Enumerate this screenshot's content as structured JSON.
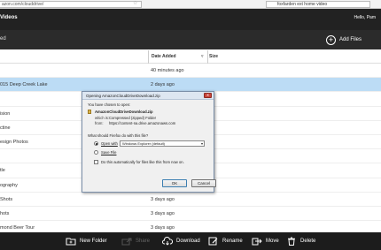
{
  "browser": {
    "url": "azon.com/clouddrive/",
    "search": "foxfarden ext home video"
  },
  "header": {
    "title": "Videos",
    "user": "Hello, Pam"
  },
  "subheader": {
    "title": "ed",
    "add_files": "Add Files"
  },
  "table": {
    "columns": {
      "date": "Date Added",
      "size": "Size"
    },
    "rows": [
      {
        "name": "",
        "date": "40 minutes ago",
        "selected": false
      },
      {
        "name": "015 Deep Creek Lake",
        "date": "2 days ago",
        "selected": true
      },
      {
        "name": "",
        "date": "",
        "selected": false
      },
      {
        "name": "ision",
        "date": "",
        "selected": false
      },
      {
        "name": "ctine",
        "date": "",
        "selected": false
      },
      {
        "name": "esign Photos",
        "date": "",
        "selected": false
      },
      {
        "name": "",
        "date": "",
        "selected": false
      },
      {
        "name": "tle",
        "date": "",
        "selected": false
      },
      {
        "name": "ography",
        "date": "",
        "selected": false
      },
      {
        "name": "Shots",
        "date": "3 days ago",
        "selected": false
      },
      {
        "name": "hots",
        "date": "3 days ago",
        "selected": false
      },
      {
        "name": "mond Beer Tour",
        "date": "3 days ago",
        "selected": false
      }
    ]
  },
  "toolbar": {
    "new_folder": "New Folder",
    "share": "Share",
    "download": "Download",
    "rename": "Rename",
    "move": "Move",
    "delete": "Delete"
  },
  "dialog": {
    "title": "Opening AmazonCloudDriveDownload.zip",
    "chosen": "You have chosen to open:",
    "filename": "AmazonCloudDriveDownload.zip",
    "which_is_label": "which is:",
    "which_is_value": "Compressed (zipped) Folder",
    "from_label": "from:",
    "from_value": "https://content-na.drive.amazonaws.com",
    "question": "What should Firefox do with this file?",
    "open_with_label": "Open with",
    "open_with_value": "Windows Explorer (default)",
    "save_file": "Save File",
    "auto_checkbox": "Do this automatically for files like this from now on.",
    "ok": "OK",
    "cancel": "Cancel"
  },
  "colors": {
    "selected_row": "#bcdcf5",
    "header_bg": "#222222",
    "toolbar_bg": "#1c1c1c"
  }
}
